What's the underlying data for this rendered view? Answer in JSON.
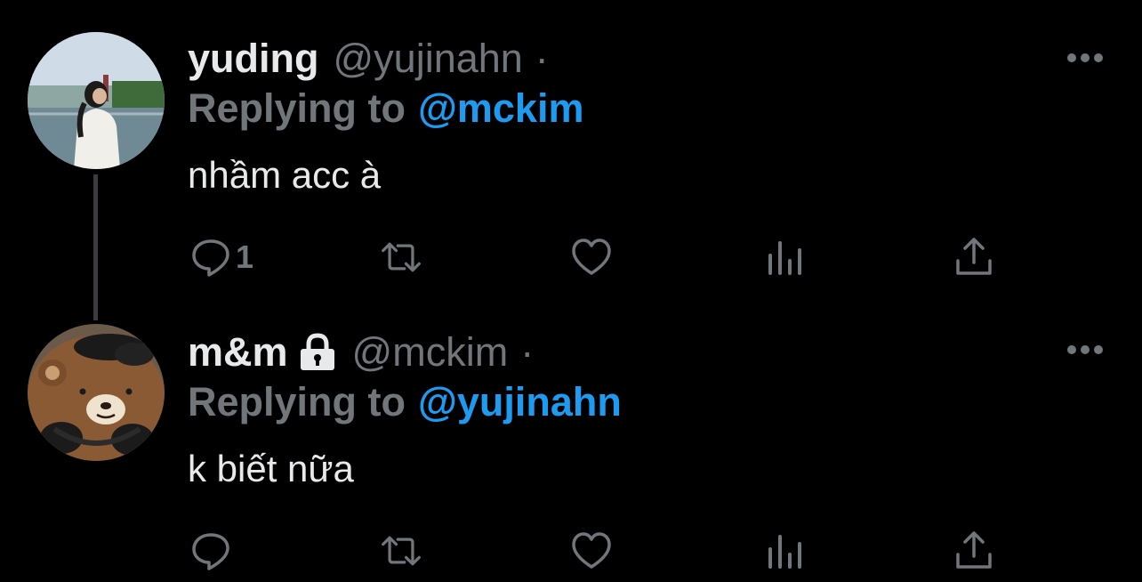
{
  "colors": {
    "background": "#000000",
    "text_primary": "#e7e9ea",
    "text_secondary": "#71767b",
    "accent": "#1d9bf0",
    "thread_line": "#3a3c3f"
  },
  "tweets": [
    {
      "display_name": "yuding",
      "handle": "@yujinahn",
      "dot": "·",
      "reply_prefix": "Replying to",
      "reply_to": "@mckim",
      "text": "nhầm acc à",
      "reply_count": "1",
      "locked": false,
      "avatar": "avatar-photo-woman-by-river",
      "icons": [
        "reply-icon",
        "retweet-icon",
        "like-icon",
        "stats-icon",
        "share-icon",
        "more-icon"
      ]
    },
    {
      "display_name": "m&m",
      "handle": "@mckim",
      "dot": "·",
      "reply_prefix": "Replying to",
      "reply_to": "@yujinahn",
      "text": "k biết nữa",
      "reply_count": "",
      "locked": true,
      "avatar": "avatar-photo-teddy-bear",
      "icons": [
        "lock-icon",
        "reply-icon",
        "retweet-icon",
        "like-icon",
        "stats-icon",
        "share-icon",
        "more-icon"
      ]
    }
  ]
}
